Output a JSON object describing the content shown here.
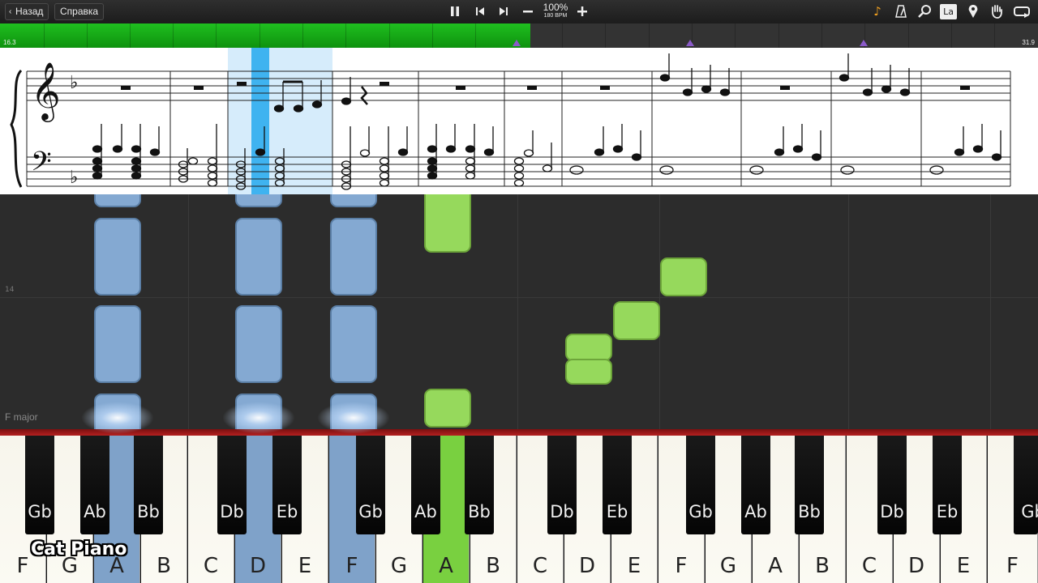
{
  "toolbar": {
    "back_label": "Назад",
    "help_label": "Справка",
    "zoom": "100%",
    "bpm": "180 BPM",
    "right_icons": [
      "note-color-icon",
      "metronome-icon",
      "magnifier-icon",
      "la-label-icon",
      "marker-icon",
      "hand-icon",
      "loop-icon"
    ],
    "la_label": "La"
  },
  "progress": {
    "start": "16.3",
    "end": "31.9",
    "played_fraction": 0.511,
    "fill_color": "#17a817",
    "marker_color": "#8a5ac8"
  },
  "roll": {
    "measure_label": "14",
    "key_signature": "F major"
  },
  "keyboard": {
    "white_keys": [
      "F",
      "G",
      "A",
      "B",
      "C",
      "D",
      "E",
      "F",
      "G",
      "A",
      "B",
      "C",
      "D",
      "E",
      "F",
      "G",
      "A",
      "B",
      "C",
      "D",
      "E",
      "F"
    ],
    "black_keys": [
      "Gb",
      "Ab",
      "Bb",
      "Db",
      "Eb",
      "Gb",
      "Ab",
      "Bb",
      "Db",
      "Eb",
      "Gb",
      "Ab",
      "Bb",
      "Db",
      "Eb",
      "Gb"
    ],
    "active_blue_color": "#7fa2c9",
    "active_green_color": "#79d040"
  },
  "logo": "Cat Piano"
}
